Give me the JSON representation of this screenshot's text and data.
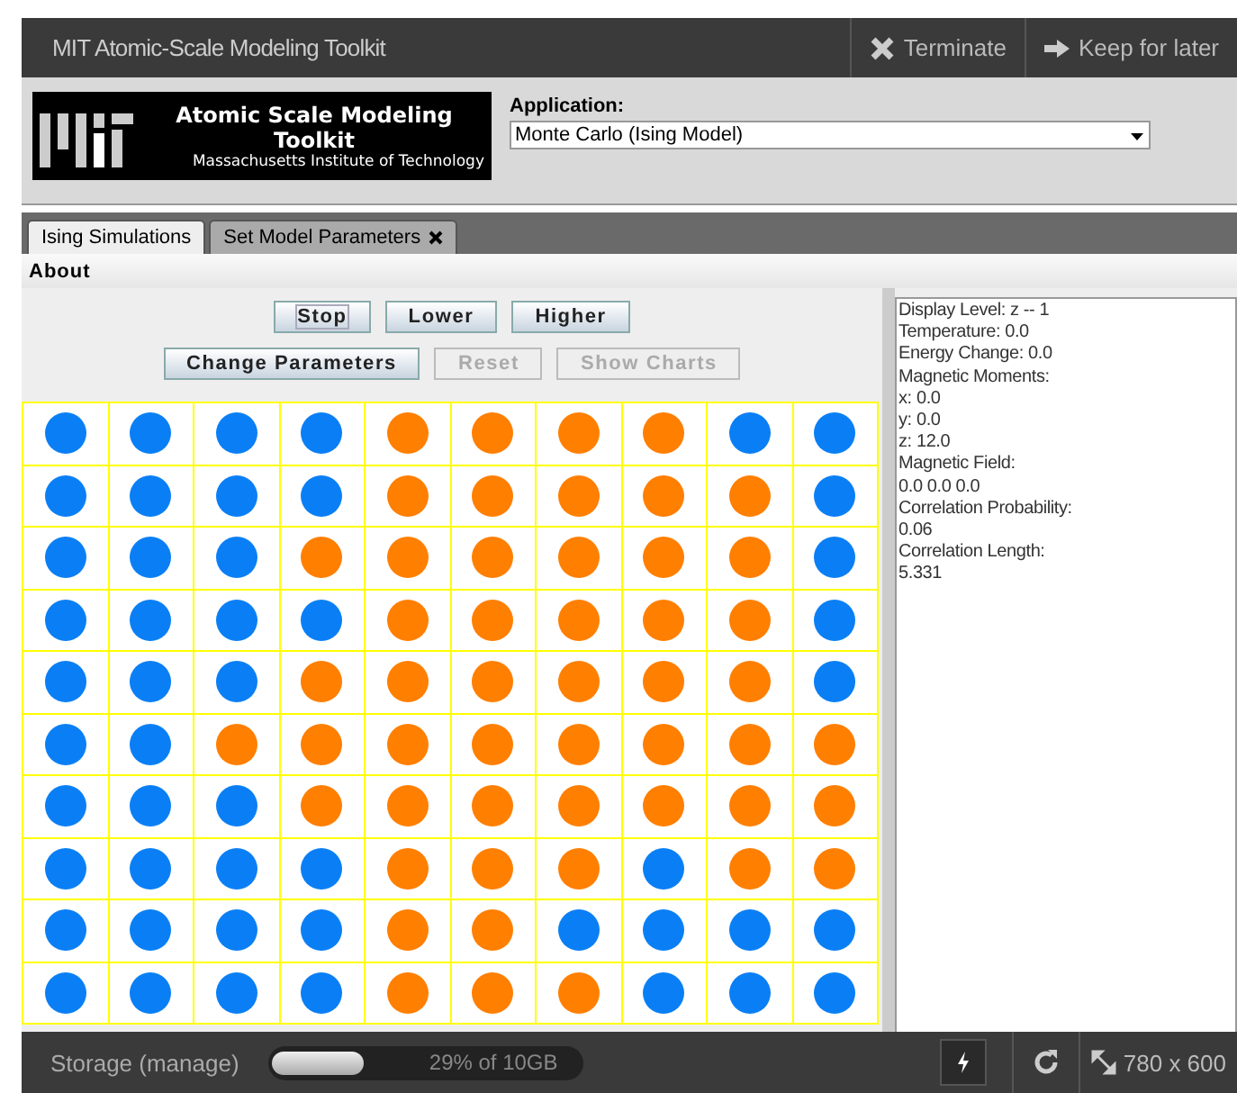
{
  "window": {
    "title": "MIT Atomic-Scale Modeling Toolkit",
    "actions": [
      {
        "kind": "terminate",
        "label": "Terminate"
      },
      {
        "kind": "keep",
        "label": "Keep for later"
      }
    ]
  },
  "logo": {
    "title_line_1": "Atomic Scale Modeling",
    "title_line_2": "Toolkit",
    "subtitle": "Massachusetts Institute of Technology"
  },
  "application": {
    "label": "Application:",
    "value": "Monte Carlo (Ising Model)"
  },
  "tabs": [
    {
      "label": "Ising Simulations",
      "selected": true,
      "closable": false
    },
    {
      "label": "Set Model Parameters",
      "selected": false,
      "closable": true
    }
  ],
  "menu": [
    "About"
  ],
  "button_rows": [
    [
      {
        "label": "Stop",
        "disabled": false,
        "focused": true
      },
      {
        "label": "Lower",
        "disabled": false,
        "focused": false
      },
      {
        "label": "Higher",
        "disabled": false,
        "focused": false
      }
    ],
    [
      {
        "label": "Change Parameters",
        "disabled": false,
        "focused": false
      },
      {
        "label": "Reset",
        "disabled": true,
        "focused": false
      },
      {
        "label": "Show Charts",
        "disabled": true,
        "focused": false
      }
    ]
  ],
  "lattice": [
    {
      "cells": [
        {
          "up": true
        },
        {
          "up": true
        },
        {
          "up": true
        },
        {
          "up": true
        },
        {
          "up": false
        },
        {
          "up": false
        },
        {
          "up": false
        },
        {
          "up": false
        },
        {
          "up": true
        },
        {
          "up": true
        }
      ]
    },
    {
      "cells": [
        {
          "up": true
        },
        {
          "up": true
        },
        {
          "up": true
        },
        {
          "up": true
        },
        {
          "up": false
        },
        {
          "up": false
        },
        {
          "up": false
        },
        {
          "up": false
        },
        {
          "up": false
        },
        {
          "up": true
        }
      ]
    },
    {
      "cells": [
        {
          "up": true
        },
        {
          "up": true
        },
        {
          "up": true
        },
        {
          "up": false
        },
        {
          "up": false
        },
        {
          "up": false
        },
        {
          "up": false
        },
        {
          "up": false
        },
        {
          "up": false
        },
        {
          "up": true
        }
      ]
    },
    {
      "cells": [
        {
          "up": true
        },
        {
          "up": true
        },
        {
          "up": true
        },
        {
          "up": true
        },
        {
          "up": false
        },
        {
          "up": false
        },
        {
          "up": false
        },
        {
          "up": false
        },
        {
          "up": false
        },
        {
          "up": true
        }
      ]
    },
    {
      "cells": [
        {
          "up": true
        },
        {
          "up": true
        },
        {
          "up": true
        },
        {
          "up": false
        },
        {
          "up": false
        },
        {
          "up": false
        },
        {
          "up": false
        },
        {
          "up": false
        },
        {
          "up": false
        },
        {
          "up": true
        }
      ]
    },
    {
      "cells": [
        {
          "up": true
        },
        {
          "up": true
        },
        {
          "up": false
        },
        {
          "up": false
        },
        {
          "up": false
        },
        {
          "up": false
        },
        {
          "up": false
        },
        {
          "up": false
        },
        {
          "up": false
        },
        {
          "up": false
        }
      ]
    },
    {
      "cells": [
        {
          "up": true
        },
        {
          "up": true
        },
        {
          "up": true
        },
        {
          "up": false
        },
        {
          "up": false
        },
        {
          "up": false
        },
        {
          "up": false
        },
        {
          "up": false
        },
        {
          "up": false
        },
        {
          "up": false
        }
      ]
    },
    {
      "cells": [
        {
          "up": true
        },
        {
          "up": true
        },
        {
          "up": true
        },
        {
          "up": true
        },
        {
          "up": false
        },
        {
          "up": false
        },
        {
          "up": false
        },
        {
          "up": true
        },
        {
          "up": false
        },
        {
          "up": false
        }
      ]
    },
    {
      "cells": [
        {
          "up": true
        },
        {
          "up": true
        },
        {
          "up": true
        },
        {
          "up": true
        },
        {
          "up": false
        },
        {
          "up": false
        },
        {
          "up": true
        },
        {
          "up": true
        },
        {
          "up": true
        },
        {
          "up": true
        }
      ]
    },
    {
      "cells": [
        {
          "up": true
        },
        {
          "up": true
        },
        {
          "up": true
        },
        {
          "up": true
        },
        {
          "up": false
        },
        {
          "up": false
        },
        {
          "up": false
        },
        {
          "up": true
        },
        {
          "up": true
        },
        {
          "up": true
        }
      ]
    }
  ],
  "info_lines": [
    "Display Level: z -- 1",
    "Temperature: 0.0",
    "Energy Change: 0.0",
    "Magnetic Moments:",
    "x: 0.0",
    "y: 0.0",
    "z: 12.0",
    "Magnetic Field:",
    "0.0 0.0 0.0",
    "Correlation Probability:",
    "0.06",
    "Correlation Length:",
    "5.331"
  ],
  "status_bar": {
    "storage_label": "Storage (manage)",
    "storage": {
      "level": 0.29,
      "text": "29% of 10GB"
    },
    "size": "780 x 600"
  }
}
